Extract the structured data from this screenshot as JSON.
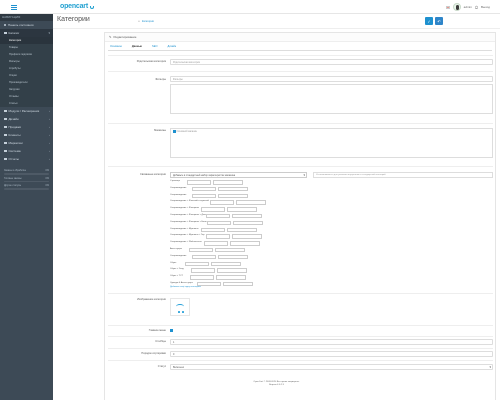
{
  "header": {
    "logo": "opencart",
    "user_name": "admin",
    "user_role": "Администратор",
    "logout_label": "Выход"
  },
  "sidebar": {
    "nav_head": "НАВИГАЦИЯ",
    "items": [
      {
        "label": "Панель состояния"
      },
      {
        "label": "Каталог",
        "active": true
      },
      {
        "label": "Модули / Расширения"
      },
      {
        "label": "Дизайн"
      },
      {
        "label": "Продажи"
      },
      {
        "label": "Клиенты"
      },
      {
        "label": "Маркетинг"
      },
      {
        "label": "Система"
      },
      {
        "label": "Отчеты"
      }
    ],
    "catalog_sub": [
      {
        "label": "Категории",
        "current": true
      },
      {
        "label": "Товары"
      },
      {
        "label": "Профили подписки"
      },
      {
        "label": "Фильтры"
      },
      {
        "label": "Атрибуты"
      },
      {
        "label": "Опции"
      },
      {
        "label": "Производители"
      },
      {
        "label": "Загрузки"
      },
      {
        "label": "Отзывы"
      },
      {
        "label": "Статьи"
      }
    ],
    "progress": [
      {
        "label": "Заказы в обработке",
        "value": "0%"
      },
      {
        "label": "Готовые заказы",
        "value": "0%"
      },
      {
        "label": "Другие статусы",
        "value": "0%"
      }
    ]
  },
  "page": {
    "title": "Категории",
    "breadcrumb": [
      "Главная",
      "Категории"
    ]
  },
  "panel": {
    "heading": "Редактирование",
    "tabs": [
      "Основное",
      "Данные",
      "SEO",
      "Дизайн"
    ],
    "active_tab": 1
  },
  "form": {
    "parent_label": "Родительская категория",
    "parent_placeholder": "Родительская категория",
    "filters_label": "Фильтры",
    "filters_placeholder": "Фильтры",
    "stores_label": "Магазины",
    "stores_default": "Основной магазин",
    "mapping_label": "Связанные категории",
    "mapping_select": "Добавьте в стандартный набор характеристик магазина",
    "mapping_help": "Устанавливается для указания внутренних и стандартной категорий",
    "mapping_rows": [
      "Страница",
      "Сопровождение",
      "Сопровождение",
      "Сопровождение > Женский и мужской",
      "Сопровождение > Женщины",
      "Сопровождение > Женщины > Дом",
      "Сопровождение > Женщины > Баня",
      "Сопровождение > Мужчины",
      "Сопровождение > Мужчины > Тор",
      "Сопровождение > Web-каталог",
      "Аксессуары",
      "Сопровождение",
      "Обувь",
      "Обувь > Уход",
      "Обувь > ТСТ",
      "Одежда & Аксессуары"
    ],
    "mapping_hint": "Добавить ещё одну категорию",
    "image_label": "Изображение категории",
    "top_label": "Главное меню",
    "columns_label": "Столбцы",
    "columns_value": "1",
    "sort_label": "Порядок сортировки",
    "sort_value": "0",
    "status_label": "Статус",
    "status_value": "Включено"
  },
  "footer": {
    "line1": "OpenCart © 2009-2024 Все права защищены.",
    "line2": "Версия 4.0.2.3"
  },
  "colors": {
    "accent": "#1e91cf",
    "sidebar": "#3d4a56"
  }
}
